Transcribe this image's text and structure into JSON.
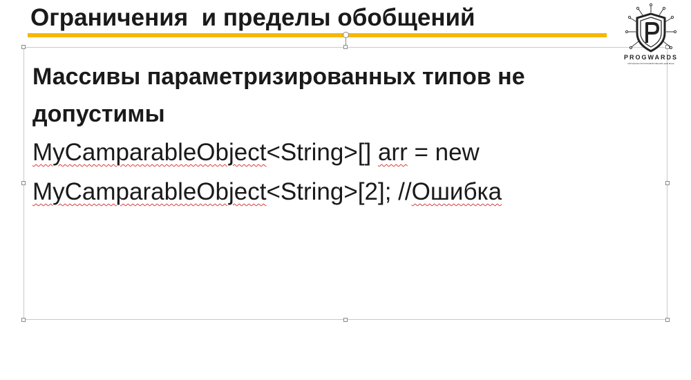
{
  "slide": {
    "title": "Ограничения  и пределы обобщений",
    "accent_color": "#f5b800"
  },
  "content": {
    "heading_line_1": "Массивы параметризированных типов не",
    "heading_line_2": "допустимы",
    "code_line_1": {
      "class_name": "MyCamparableObject",
      "rest_a": "<String>[] ",
      "var_name": "arr",
      "rest_b": " = new"
    },
    "code_line_2": {
      "class_name": "MyCamparableObject",
      "rest_a": "<String>[2]; //",
      "comment": "Ошибка"
    }
  },
  "logo": {
    "icon": "progwards-shield-logo",
    "wordmark": "PROGWARDS",
    "tagline": "ОБУЧЕНИЕ ПРОГРАММИРОВАНИЮ ДЛЯ ВСЕХ"
  }
}
